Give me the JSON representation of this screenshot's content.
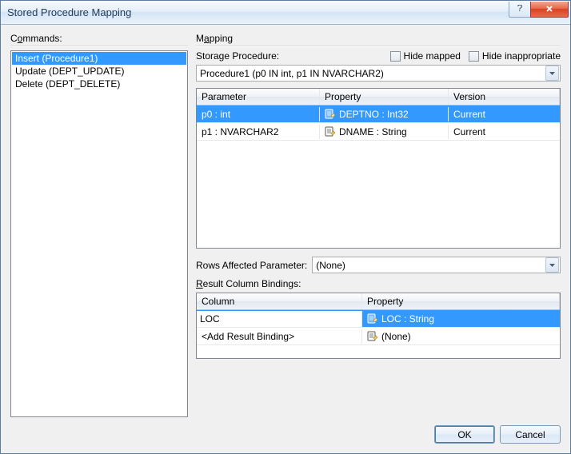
{
  "window": {
    "title": "Stored Procedure Mapping"
  },
  "commands": {
    "label_pre": "C",
    "label_ul": "o",
    "label_post": "mmands:",
    "items": [
      "Insert (Procedure1)",
      "Update (DEPT_UPDATE)",
      "Delete (DEPT_DELETE)"
    ],
    "selected_index": 0
  },
  "mapping": {
    "label_pre": "M",
    "label_ul": "a",
    "label_post": "pping",
    "storage_proc_label_pre": "Storage ",
    "storage_proc_label_ul": "P",
    "storage_proc_label_post": "rocedure:",
    "hide_mapped_pre": "Hide ",
    "hide_mapped_ul": "m",
    "hide_mapped_post": "apped",
    "hide_inapp_pre": "Hide ",
    "hide_inapp_ul": "i",
    "hide_inapp_post": "nappropriate",
    "procedure_value": "Procedure1 (p0 IN int, p1 IN NVARCHAR2)",
    "param_grid": {
      "headers": {
        "parameter": "Parameter",
        "property": "Property",
        "version": "Version"
      },
      "rows": [
        {
          "parameter": "p0 : int",
          "property": "DEPTNO : Int32",
          "version": "Current",
          "selected": true
        },
        {
          "parameter": "p1 : NVARCHAR2",
          "property": "DNAME : String",
          "version": "Current",
          "selected": false
        }
      ]
    },
    "rows_affected_label_pre": "Rows A",
    "rows_affected_label_ul": "f",
    "rows_affected_label_post": "fected Parameter:",
    "rows_affected_value": "(None)",
    "result_label_pre": "",
    "result_label_ul": "R",
    "result_label_post": "esult Column Bindings:",
    "result_grid": {
      "headers": {
        "column": "Column",
        "property": "Property"
      },
      "rows": [
        {
          "column": "LOC",
          "property": "LOC : String",
          "selected": true,
          "editing": true
        },
        {
          "column": "<Add Result Binding>",
          "property": "(None)",
          "selected": false,
          "editing": false
        }
      ]
    }
  },
  "buttons": {
    "ok": "OK",
    "cancel": "Cancel"
  }
}
